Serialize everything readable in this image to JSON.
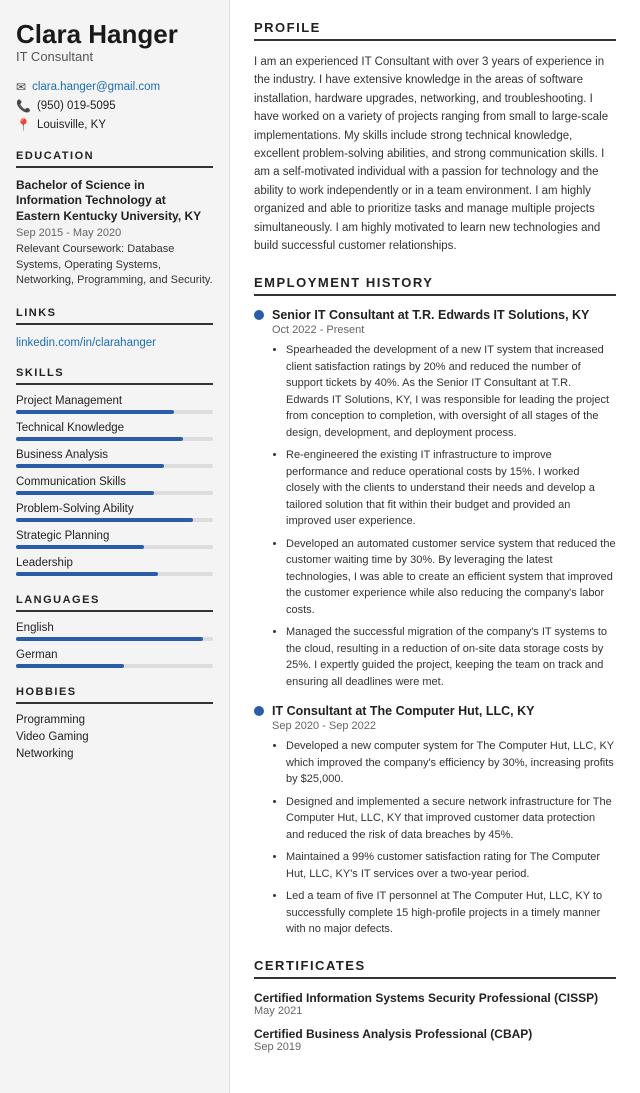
{
  "sidebar": {
    "name": "Clara Hanger",
    "title": "IT Consultant",
    "contact": {
      "email": "clara.hanger@gmail.com",
      "phone": "(950) 019-5095",
      "location": "Louisville, KY"
    },
    "education": {
      "section_title": "EDUCATION",
      "degree": "Bachelor of Science in Information Technology at Eastern Kentucky University, KY",
      "date": "Sep 2015 - May 2020",
      "coursework_label": "Relevant Coursework:",
      "coursework": "Database Systems, Operating Systems, Networking, Programming, and Security."
    },
    "links": {
      "section_title": "LINKS",
      "url": "linkedin.com/in/clarahanger"
    },
    "skills": {
      "section_title": "SKILLS",
      "items": [
        {
          "name": "Project Management",
          "pct": 80
        },
        {
          "name": "Technical Knowledge",
          "pct": 85
        },
        {
          "name": "Business Analysis",
          "pct": 75
        },
        {
          "name": "Communication Skills",
          "pct": 70
        },
        {
          "name": "Problem-Solving Ability",
          "pct": 90
        },
        {
          "name": "Strategic Planning",
          "pct": 65
        },
        {
          "name": "Leadership",
          "pct": 72
        }
      ]
    },
    "languages": {
      "section_title": "LANGUAGES",
      "items": [
        {
          "name": "English",
          "pct": 95
        },
        {
          "name": "German",
          "pct": 55
        }
      ]
    },
    "hobbies": {
      "section_title": "HOBBIES",
      "items": [
        "Programming",
        "Video Gaming",
        "Networking"
      ]
    }
  },
  "main": {
    "profile": {
      "section_title": "PROFILE",
      "text": "I am an experienced IT Consultant with over 3 years of experience in the industry. I have extensive knowledge in the areas of software installation, hardware upgrades, networking, and troubleshooting. I have worked on a variety of projects ranging from small to large-scale implementations. My skills include strong technical knowledge, excellent problem-solving abilities, and strong communication skills. I am a self-motivated individual with a passion for technology and the ability to work independently or in a team environment. I am highly organized and able to prioritize tasks and manage multiple projects simultaneously. I am highly motivated to learn new technologies and build successful customer relationships."
    },
    "employment": {
      "section_title": "EMPLOYMENT HISTORY",
      "jobs": [
        {
          "title": "Senior IT Consultant at T.R. Edwards IT Solutions, KY",
          "date": "Oct 2022 - Present",
          "bullets": [
            "Spearheaded the development of a new IT system that increased client satisfaction ratings by 20% and reduced the number of support tickets by 40%. As the Senior IT Consultant at T.R. Edwards IT Solutions, KY, I was responsible for leading the project from conception to completion, with oversight of all stages of the design, development, and deployment process.",
            "Re-engineered the existing IT infrastructure to improve performance and reduce operational costs by 15%. I worked closely with the clients to understand their needs and develop a tailored solution that fit within their budget and provided an improved user experience.",
            "Developed an automated customer service system that reduced the customer waiting time by 30%. By leveraging the latest technologies, I was able to create an efficient system that improved the customer experience while also reducing the company's labor costs.",
            "Managed the successful migration of the company's IT systems to the cloud, resulting in a reduction of on-site data storage costs by 25%. I expertly guided the project, keeping the team on track and ensuring all deadlines were met."
          ]
        },
        {
          "title": "IT Consultant at The Computer Hut, LLC, KY",
          "date": "Sep 2020 - Sep 2022",
          "bullets": [
            "Developed a new computer system for The Computer Hut, LLC, KY which improved the company's efficiency by 30%, increasing profits by $25,000.",
            "Designed and implemented a secure network infrastructure for The Computer Hut, LLC, KY that improved customer data protection and reduced the risk of data breaches by 45%.",
            "Maintained a 99% customer satisfaction rating for The Computer Hut, LLC, KY's IT services over a two-year period.",
            "Led a team of five IT personnel at The Computer Hut, LLC, KY to successfully complete 15 high-profile projects in a timely manner with no major defects."
          ]
        }
      ]
    },
    "certificates": {
      "section_title": "CERTIFICATES",
      "items": [
        {
          "name": "Certified Information Systems Security Professional (CISSP)",
          "date": "May 2021"
        },
        {
          "name": "Certified Business Analysis Professional (CBAP)",
          "date": "Sep 2019"
        }
      ]
    }
  }
}
